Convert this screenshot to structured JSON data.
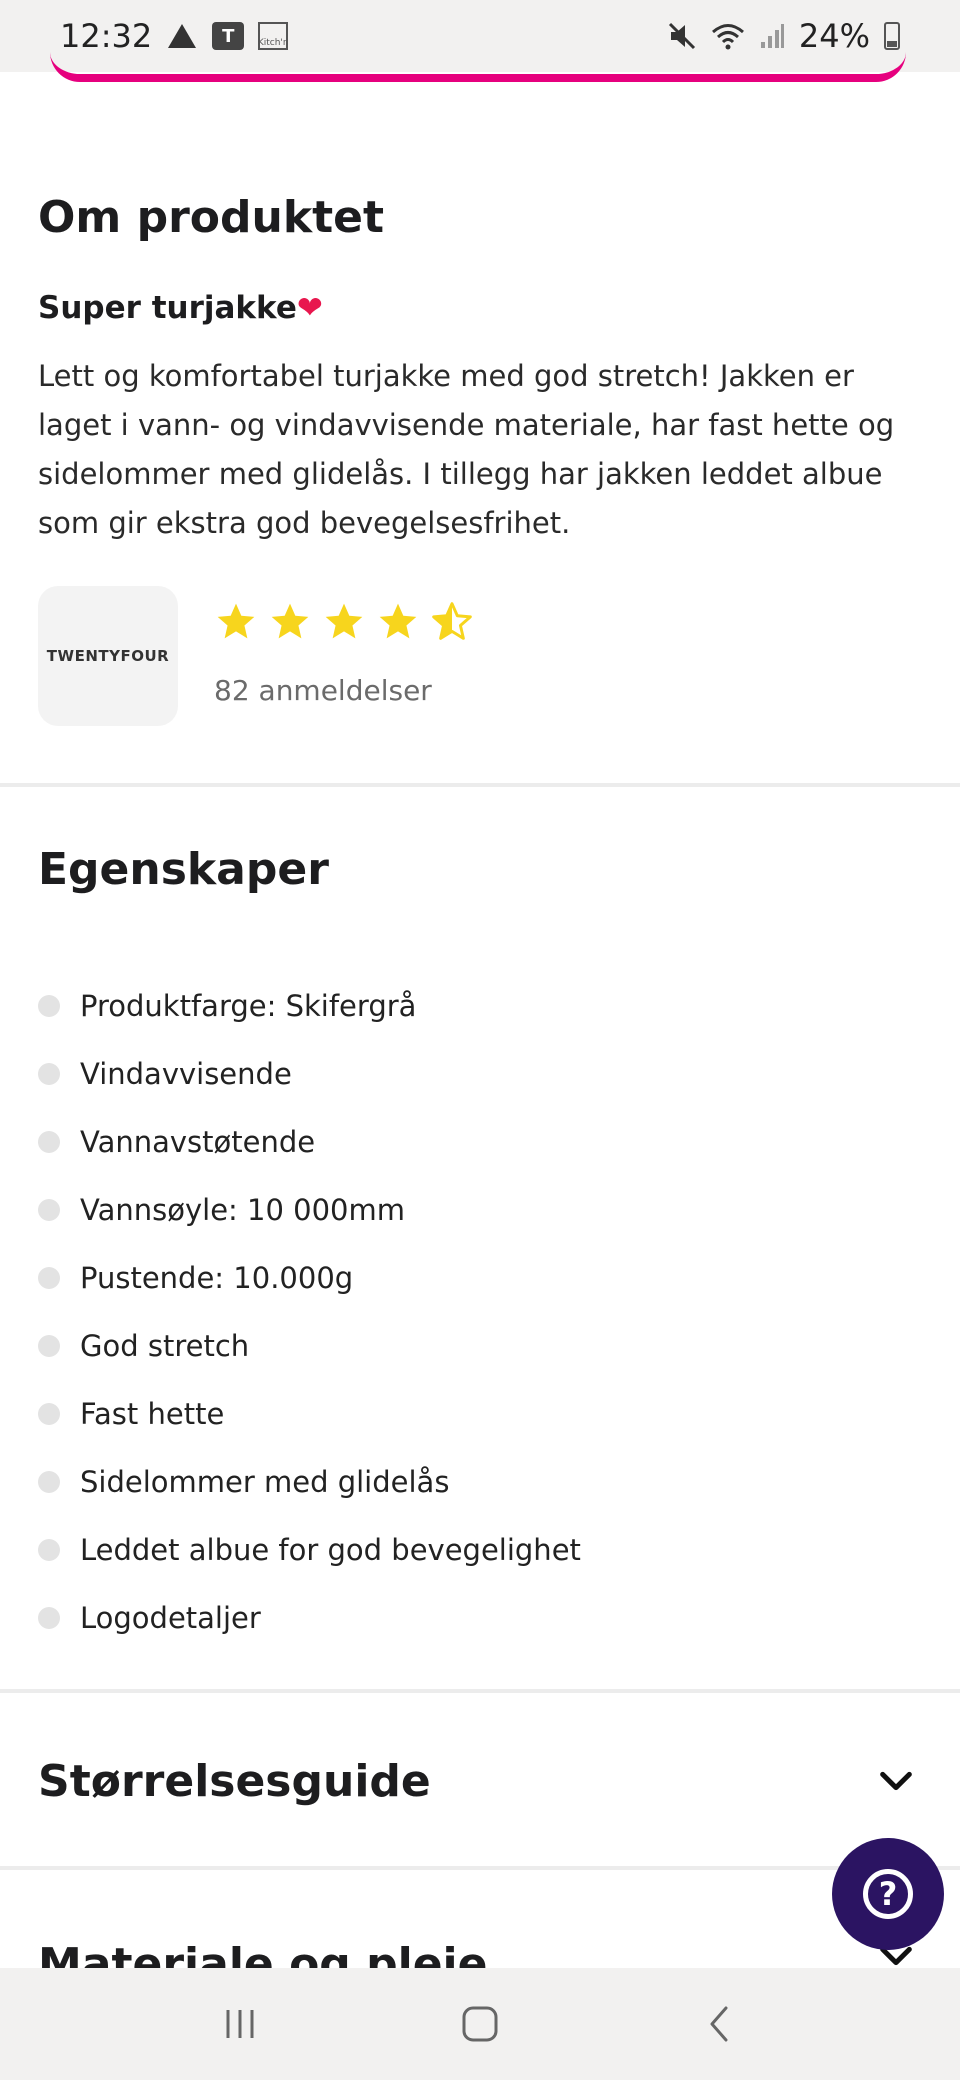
{
  "status_bar": {
    "time": "12:32",
    "battery": "24%",
    "left_icons": [
      "warning-icon",
      "teams-icon",
      "kitchn-icon"
    ],
    "right_icons": [
      "mute-icon",
      "wifi-icon",
      "signal-icon",
      "battery-icon"
    ],
    "teams_label": "T",
    "kitchn_label": "Kitch'n"
  },
  "about": {
    "title": "Om produktet",
    "subtitle": "Super turjakke",
    "subtitle_emoji": "❤",
    "description": "Lett og komfortabel turjakke med god stretch! Jakken er laget i vann- og vindavvisende materiale, har fast hette og sidelommer med glidelås. I tillegg har jakken leddet albue som gir ekstra god bevegelsesfrihet.",
    "brand_logo_text": "TWENTYFOUR",
    "rating": 4.5,
    "rating_max": 5,
    "reviews": "82 anmeldelser",
    "star_color": "#f7d51d"
  },
  "features": {
    "title": "Egenskaper",
    "items": [
      "Produktfarge: Skifergrå",
      "Vindavvisende",
      "Vannavstøtende",
      "Vannsøyle: 10 000mm",
      "Pustende: 10.000g",
      "God stretch",
      "Fast hette",
      "Sidelommer med glidelås",
      "Leddet albue for god bevegelighet",
      "Logodetaljer"
    ]
  },
  "accordions": {
    "size_guide": "Størrelsesguide",
    "material": "Materiale og pleie"
  },
  "help_button": {
    "label": "?",
    "color": "#2b1462"
  },
  "accent_color": "#e6007e"
}
